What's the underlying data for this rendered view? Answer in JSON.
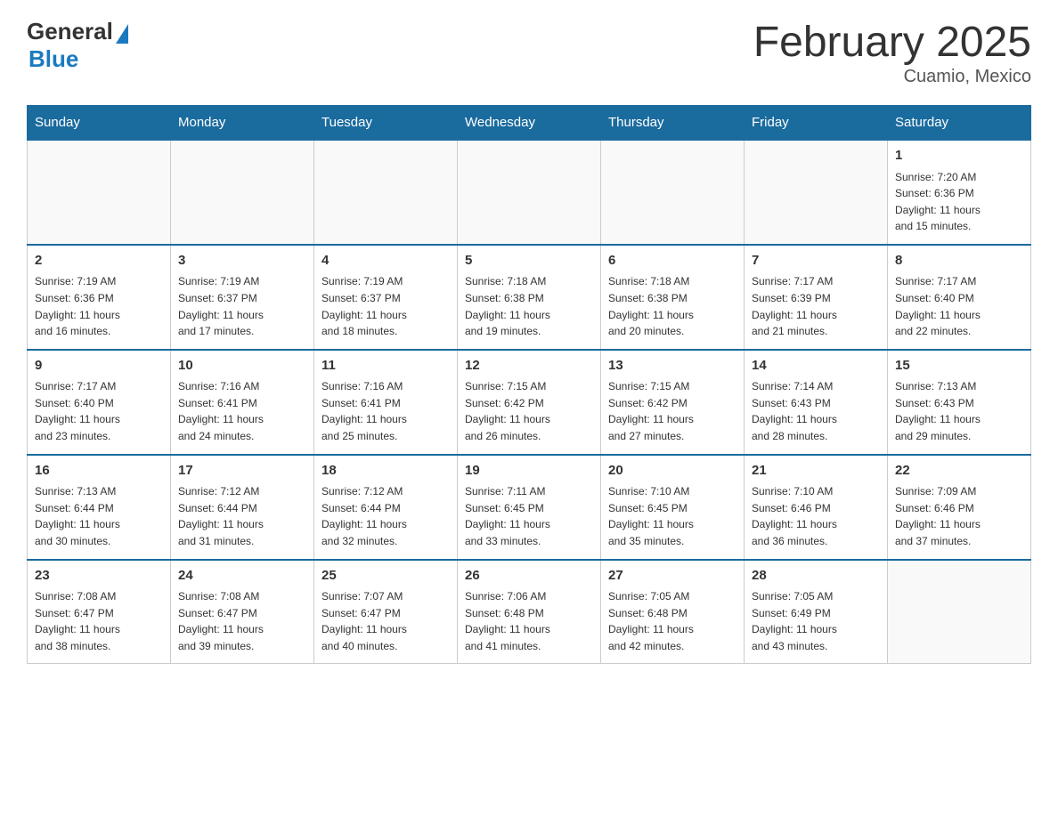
{
  "header": {
    "logo_general": "General",
    "logo_blue": "Blue",
    "month_title": "February 2025",
    "location": "Cuamio, Mexico"
  },
  "calendar": {
    "days_of_week": [
      "Sunday",
      "Monday",
      "Tuesday",
      "Wednesday",
      "Thursday",
      "Friday",
      "Saturday"
    ],
    "weeks": [
      [
        {
          "day": "",
          "info": ""
        },
        {
          "day": "",
          "info": ""
        },
        {
          "day": "",
          "info": ""
        },
        {
          "day": "",
          "info": ""
        },
        {
          "day": "",
          "info": ""
        },
        {
          "day": "",
          "info": ""
        },
        {
          "day": "1",
          "info": "Sunrise: 7:20 AM\nSunset: 6:36 PM\nDaylight: 11 hours\nand 15 minutes."
        }
      ],
      [
        {
          "day": "2",
          "info": "Sunrise: 7:19 AM\nSunset: 6:36 PM\nDaylight: 11 hours\nand 16 minutes."
        },
        {
          "day": "3",
          "info": "Sunrise: 7:19 AM\nSunset: 6:37 PM\nDaylight: 11 hours\nand 17 minutes."
        },
        {
          "day": "4",
          "info": "Sunrise: 7:19 AM\nSunset: 6:37 PM\nDaylight: 11 hours\nand 18 minutes."
        },
        {
          "day": "5",
          "info": "Sunrise: 7:18 AM\nSunset: 6:38 PM\nDaylight: 11 hours\nand 19 minutes."
        },
        {
          "day": "6",
          "info": "Sunrise: 7:18 AM\nSunset: 6:38 PM\nDaylight: 11 hours\nand 20 minutes."
        },
        {
          "day": "7",
          "info": "Sunrise: 7:17 AM\nSunset: 6:39 PM\nDaylight: 11 hours\nand 21 minutes."
        },
        {
          "day": "8",
          "info": "Sunrise: 7:17 AM\nSunset: 6:40 PM\nDaylight: 11 hours\nand 22 minutes."
        }
      ],
      [
        {
          "day": "9",
          "info": "Sunrise: 7:17 AM\nSunset: 6:40 PM\nDaylight: 11 hours\nand 23 minutes."
        },
        {
          "day": "10",
          "info": "Sunrise: 7:16 AM\nSunset: 6:41 PM\nDaylight: 11 hours\nand 24 minutes."
        },
        {
          "day": "11",
          "info": "Sunrise: 7:16 AM\nSunset: 6:41 PM\nDaylight: 11 hours\nand 25 minutes."
        },
        {
          "day": "12",
          "info": "Sunrise: 7:15 AM\nSunset: 6:42 PM\nDaylight: 11 hours\nand 26 minutes."
        },
        {
          "day": "13",
          "info": "Sunrise: 7:15 AM\nSunset: 6:42 PM\nDaylight: 11 hours\nand 27 minutes."
        },
        {
          "day": "14",
          "info": "Sunrise: 7:14 AM\nSunset: 6:43 PM\nDaylight: 11 hours\nand 28 minutes."
        },
        {
          "day": "15",
          "info": "Sunrise: 7:13 AM\nSunset: 6:43 PM\nDaylight: 11 hours\nand 29 minutes."
        }
      ],
      [
        {
          "day": "16",
          "info": "Sunrise: 7:13 AM\nSunset: 6:44 PM\nDaylight: 11 hours\nand 30 minutes."
        },
        {
          "day": "17",
          "info": "Sunrise: 7:12 AM\nSunset: 6:44 PM\nDaylight: 11 hours\nand 31 minutes."
        },
        {
          "day": "18",
          "info": "Sunrise: 7:12 AM\nSunset: 6:44 PM\nDaylight: 11 hours\nand 32 minutes."
        },
        {
          "day": "19",
          "info": "Sunrise: 7:11 AM\nSunset: 6:45 PM\nDaylight: 11 hours\nand 33 minutes."
        },
        {
          "day": "20",
          "info": "Sunrise: 7:10 AM\nSunset: 6:45 PM\nDaylight: 11 hours\nand 35 minutes."
        },
        {
          "day": "21",
          "info": "Sunrise: 7:10 AM\nSunset: 6:46 PM\nDaylight: 11 hours\nand 36 minutes."
        },
        {
          "day": "22",
          "info": "Sunrise: 7:09 AM\nSunset: 6:46 PM\nDaylight: 11 hours\nand 37 minutes."
        }
      ],
      [
        {
          "day": "23",
          "info": "Sunrise: 7:08 AM\nSunset: 6:47 PM\nDaylight: 11 hours\nand 38 minutes."
        },
        {
          "day": "24",
          "info": "Sunrise: 7:08 AM\nSunset: 6:47 PM\nDaylight: 11 hours\nand 39 minutes."
        },
        {
          "day": "25",
          "info": "Sunrise: 7:07 AM\nSunset: 6:47 PM\nDaylight: 11 hours\nand 40 minutes."
        },
        {
          "day": "26",
          "info": "Sunrise: 7:06 AM\nSunset: 6:48 PM\nDaylight: 11 hours\nand 41 minutes."
        },
        {
          "day": "27",
          "info": "Sunrise: 7:05 AM\nSunset: 6:48 PM\nDaylight: 11 hours\nand 42 minutes."
        },
        {
          "day": "28",
          "info": "Sunrise: 7:05 AM\nSunset: 6:49 PM\nDaylight: 11 hours\nand 43 minutes."
        },
        {
          "day": "",
          "info": ""
        }
      ]
    ]
  }
}
